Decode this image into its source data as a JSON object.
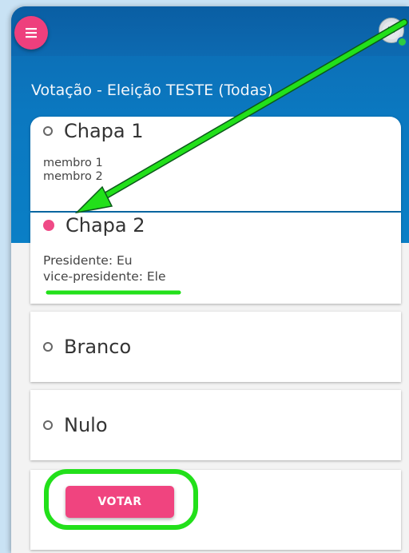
{
  "header": {
    "title": "Votação - Eleição TESTE (Todas)",
    "menu_icon": "hamburger-menu-icon",
    "avatar_icon": "user-avatar-icon"
  },
  "options": [
    {
      "label": "Chapa 1",
      "selected": false,
      "members": [
        "membro 1",
        "membro 2"
      ]
    },
    {
      "label": "Chapa 2",
      "selected": true,
      "members": [
        "Presidente: Eu",
        "vice-presidente: Ele"
      ]
    },
    {
      "label": "Branco",
      "selected": false,
      "members": []
    },
    {
      "label": "Nulo",
      "selected": false,
      "members": []
    }
  ],
  "vote_button": {
    "label": "VOTAR"
  },
  "colors": {
    "header_blue": "#0b72b9",
    "accent_pink": "#ee3f7d",
    "annotation_green": "#22e01a"
  }
}
